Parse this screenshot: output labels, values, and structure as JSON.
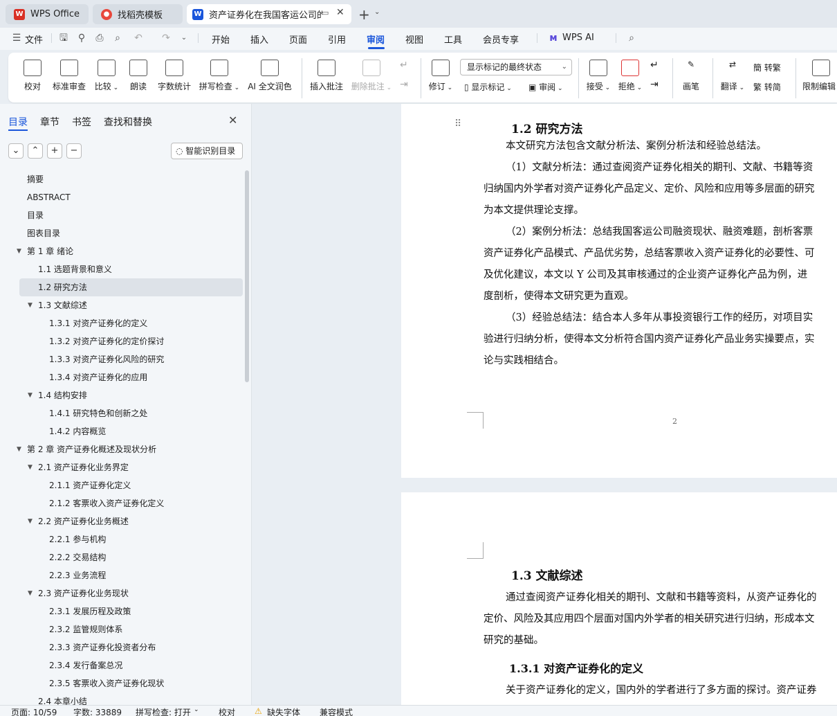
{
  "tabs": [
    {
      "label": "WPS Office",
      "icon": "wps-logo-icon",
      "color": "#d93025"
    },
    {
      "label": "找稻壳模板",
      "icon": "docer-logo-icon",
      "color": "#e8483d"
    },
    {
      "label": "资产证券化在我国客运公司的应",
      "icon": "word-doc-icon",
      "color": "#1a56db"
    }
  ],
  "menu": {
    "file": "文件",
    "items": [
      "开始",
      "插入",
      "页面",
      "引用",
      "审阅",
      "视图",
      "工具",
      "会员专享"
    ],
    "active": "审阅",
    "wps_ai": "WPS AI"
  },
  "ribbon": {
    "proofread": "校对",
    "standard_review": "标准审查",
    "compare": "比较",
    "read_aloud": "朗读",
    "word_count": "字数统计",
    "spell_check": "拼写检查",
    "ai_polish": "AI 全文润色",
    "insert_comment": "插入批注",
    "delete_comment": "删除批注",
    "track_changes": "修订",
    "markup_dropdown": "显示标记的最终状态",
    "show_markup": "显示标记",
    "review_pane": "审阅",
    "accept": "接受",
    "reject": "拒绝",
    "pen": "画笔",
    "translate": "翻译",
    "to_traditional": "转繁",
    "to_simplified": "转简",
    "restrict_edit": "限制编辑"
  },
  "sidebar": {
    "tabs": [
      "目录",
      "章节",
      "书签",
      "查找和替换"
    ],
    "active_tab": "目录",
    "smart_toc": "智能识别目录",
    "toc": [
      {
        "label": "摘要",
        "level": 0,
        "caret": false
      },
      {
        "label": "ABSTRACT",
        "level": 0,
        "caret": false
      },
      {
        "label": "目录",
        "level": 0,
        "caret": false
      },
      {
        "label": "图表目录",
        "level": 0,
        "caret": false
      },
      {
        "label": "第 1 章  绪论",
        "level": 0,
        "caret": true
      },
      {
        "label": "1.1  选题背景和意义",
        "level": 1,
        "caret": false
      },
      {
        "label": "1.2  研究方法",
        "level": 1,
        "caret": false,
        "selected": true
      },
      {
        "label": "1.3  文献综述",
        "level": 1,
        "caret": true
      },
      {
        "label": "1.3.1 对资产证券化的定义",
        "level": 2,
        "caret": false
      },
      {
        "label": "1.3.2 对资产证券化的定价探讨",
        "level": 2,
        "caret": false
      },
      {
        "label": "1.3.3 对资产证券化风险的研究",
        "level": 2,
        "caret": false
      },
      {
        "label": "1.3.4 对资产证券化的应用",
        "level": 2,
        "caret": false
      },
      {
        "label": "1.4 结构安排",
        "level": 1,
        "caret": true
      },
      {
        "label": "1.4.1  研究特色和创新之处",
        "level": 2,
        "caret": false
      },
      {
        "label": "1.4.2  内容概览",
        "level": 2,
        "caret": false
      },
      {
        "label": "第 2 章  资产证券化概述及现状分析",
        "level": 0,
        "caret": true
      },
      {
        "label": "2.1  资产证券化业务界定",
        "level": 1,
        "caret": true
      },
      {
        "label": "2.1.1 资产证券化定义",
        "level": 2,
        "caret": false
      },
      {
        "label": "2.1.2 客票收入资产证券化定义",
        "level": 2,
        "caret": false
      },
      {
        "label": "2.2  资产证券化业务概述",
        "level": 1,
        "caret": true
      },
      {
        "label": "2.2.1 参与机构",
        "level": 2,
        "caret": false
      },
      {
        "label": "2.2.2 交易结构",
        "level": 2,
        "caret": false
      },
      {
        "label": "2.2.3 业务流程",
        "level": 2,
        "caret": false
      },
      {
        "label": "2.3  资产证券化业务现状",
        "level": 1,
        "caret": true
      },
      {
        "label": "2.3.1 发展历程及政策",
        "level": 2,
        "caret": false
      },
      {
        "label": "2.3.2 监管规则体系",
        "level": 2,
        "caret": false
      },
      {
        "label": "2.3.3 资产证券化投资者分布",
        "level": 2,
        "caret": false
      },
      {
        "label": "2.3.4 发行备案总况",
        "level": 2,
        "caret": false
      },
      {
        "label": "2.3.5 客票收入资产证券化现状",
        "level": 2,
        "caret": false
      },
      {
        "label": "2.4  本章小结",
        "level": 1,
        "caret": false
      }
    ]
  },
  "document": {
    "page1": {
      "heading": "1.2  研究方法",
      "lines": [
        {
          "text": "本文研究方法包含文献分析法、案例分析法和经验总结法。",
          "indent": true
        },
        {
          "text": "（1）文献分析法：通过查阅资产证券化相关的期刊、文献、书籍等资",
          "indent": true
        },
        {
          "text": "归纳国内外学者对资产证券化产品定义、定价、风险和应用等多层面的研究",
          "indent": false
        },
        {
          "text": "为本文提供理论支撑。",
          "indent": false
        },
        {
          "text": "（2）案例分析法：总结我国客运公司融资现状、融资难题，剖析客票",
          "indent": true
        },
        {
          "text": "资产证券化产品模式、产品优劣势，总结客票收入资产证券化的必要性、可",
          "indent": false
        },
        {
          "text": "及优化建议，本文以 Y 公司及其审核通过的企业资产证券化产品为例，进",
          "indent": false
        },
        {
          "text": "度剖析，使得本文研究更为直观。",
          "indent": false
        },
        {
          "text": "（3）经验总结法：结合本人多年从事投资银行工作的经历，对项目实",
          "indent": true
        },
        {
          "text": "验进行归纳分析，使得本文分析符合国内资产证券化产品业务实操要点，实",
          "indent": false
        },
        {
          "text": "论与实践相结合。",
          "indent": false
        }
      ],
      "page_number": "2"
    },
    "page2": {
      "heading": "1.3  文献综述",
      "lines": [
        {
          "text": "通过查阅资产证券化相关的期刊、文献和书籍等资料，从资产证券化的",
          "indent": true
        },
        {
          "text": "定价、风险及其应用四个层面对国内外学者的相关研究进行归纳，形成本文",
          "indent": false
        },
        {
          "text": "研究的基础。",
          "indent": false
        }
      ],
      "subheading": "1.3.1 对资产证券化的定义",
      "sub_lines": [
        {
          "text": "关于资产证券化的定义，国内外的学者进行了多方面的探讨。资产证券",
          "indent": true
        }
      ]
    }
  },
  "status": {
    "page": "页面: 10/59",
    "word_count": "字数: 33889",
    "spell_check": "拼写检查: 打开",
    "proofread": "校对",
    "missing_font": "缺失字体",
    "compat_mode": "兼容模式"
  }
}
